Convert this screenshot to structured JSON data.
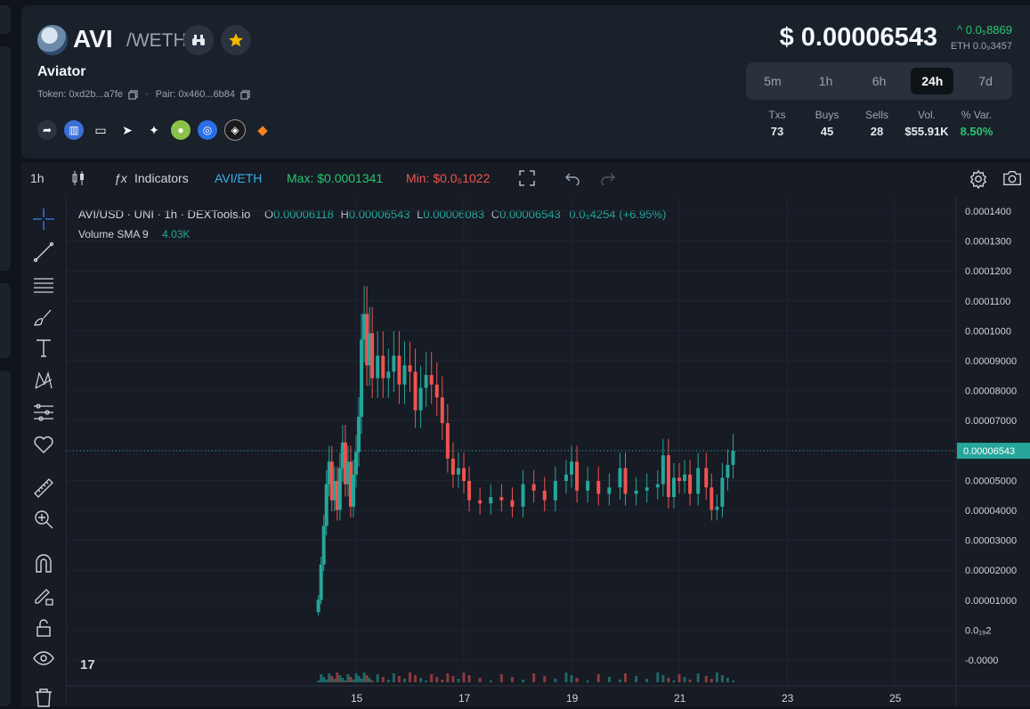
{
  "pair": {
    "base": "AVI",
    "quote": "/WETH",
    "name": "Aviator",
    "token_label": "Token: 0xd2b...a7fe",
    "pair_label": "Pair: 0x460...6b84"
  },
  "price": {
    "usd": "$ 0.00006543",
    "change": "^ 0.0₅8869",
    "eth": "ETH 0.0₉3457"
  },
  "timeframes": {
    "items": [
      "5m",
      "1h",
      "6h",
      "24h",
      "7d"
    ],
    "active": "24h"
  },
  "stats": {
    "txs_label": "Txs",
    "txs": "73",
    "buys_label": "Buys",
    "buys": "45",
    "sells_label": "Sells",
    "sells": "28",
    "vol_label": "Vol.",
    "vol": "$55.91K",
    "var_label": "% Var.",
    "var": "8.50%"
  },
  "toolbar": {
    "interval": "1h",
    "indicators": "Indicators",
    "pair": "AVI/ETH",
    "max": "Max: $0.0001341",
    "min": "Min: $0.0₅1022"
  },
  "legend": {
    "title": "AVI/USD · UNI · 1h · DEXTools.io",
    "o_lab": "O",
    "o": "0.00006118",
    "h_lab": "H",
    "h": "0.00006543",
    "l_lab": "L",
    "l": "0.00006083",
    "c_lab": "C",
    "c": "0.00006543",
    "delta": "0.0₅4254 (+6.95%)",
    "vol_label": "Volume SMA 9",
    "vol_val": "4.03K"
  },
  "colors": {
    "up": "#26a69a",
    "down": "#ef5350",
    "green": "#28c76f",
    "bg": "#161b24"
  },
  "chart_data": {
    "type": "candlestick",
    "x_ticks": [
      "15",
      "17",
      "19",
      "21",
      "23",
      "25"
    ],
    "y_ticks": [
      "0.0001400",
      "0.0001300",
      "0.0001200",
      "0.0001100",
      "0.0001000",
      "0.00009000",
      "0.00008000",
      "0.00007000",
      "0.00006000",
      "0.00005000",
      "0.00004000",
      "0.00003000",
      "0.00002000",
      "0.00001000",
      "0.0₁₉2",
      "-0.0000"
    ],
    "last_price_label": "0.00006543",
    "ylim": [
      0,
      0.00014
    ],
    "x_range": [
      13.5,
      25.5
    ],
    "series_close": [
      {
        "x": 14.3,
        "v": 1.9e-05
      },
      {
        "x": 14.35,
        "v": 3e-05
      },
      {
        "x": 14.4,
        "v": 4.2e-05
      },
      {
        "x": 14.45,
        "v": 5.5e-05
      },
      {
        "x": 14.5,
        "v": 6.2e-05
      },
      {
        "x": 14.55,
        "v": 5e-05
      },
      {
        "x": 14.6,
        "v": 5.6e-05
      },
      {
        "x": 14.65,
        "v": 4.7e-05
      },
      {
        "x": 14.7,
        "v": 6e-05
      },
      {
        "x": 14.75,
        "v": 6.8e-05
      },
      {
        "x": 14.8,
        "v": 5.5e-05
      },
      {
        "x": 14.85,
        "v": 6.2e-05
      },
      {
        "x": 14.9,
        "v": 4.8e-05
      },
      {
        "x": 14.95,
        "v": 5.8e-05
      },
      {
        "x": 15.0,
        "v": 6.5e-05
      },
      {
        "x": 15.05,
        "v": 7.6e-05
      },
      {
        "x": 15.1,
        "v": 0.0001
      },
      {
        "x": 15.15,
        "v": 0.000108
      },
      {
        "x": 15.2,
        "v": 9.2e-05
      },
      {
        "x": 15.25,
        "v": 0.000102
      },
      {
        "x": 15.3,
        "v": 8.8e-05
      },
      {
        "x": 15.4,
        "v": 9.5e-05
      },
      {
        "x": 15.5,
        "v": 8.8e-05
      },
      {
        "x": 15.6,
        "v": 9e-05
      },
      {
        "x": 15.7,
        "v": 9.5e-05
      },
      {
        "x": 15.8,
        "v": 8.6e-05
      },
      {
        "x": 15.9,
        "v": 9.2e-05
      },
      {
        "x": 16.0,
        "v": 9e-05
      },
      {
        "x": 16.1,
        "v": 7.8e-05
      },
      {
        "x": 16.2,
        "v": 8.5e-05
      },
      {
        "x": 16.3,
        "v": 8.9e-05
      },
      {
        "x": 16.4,
        "v": 8.6e-05
      },
      {
        "x": 16.5,
        "v": 8.2e-05
      },
      {
        "x": 16.6,
        "v": 7.4e-05
      },
      {
        "x": 16.7,
        "v": 6.3e-05
      },
      {
        "x": 16.8,
        "v": 5.8e-05
      },
      {
        "x": 16.9,
        "v": 6e-05
      },
      {
        "x": 17.0,
        "v": 5.6e-05
      },
      {
        "x": 17.1,
        "v": 5e-05
      },
      {
        "x": 17.3,
        "v": 4.9e-05
      },
      {
        "x": 17.5,
        "v": 5.1e-05
      },
      {
        "x": 17.7,
        "v": 5e-05
      },
      {
        "x": 17.9,
        "v": 4.8e-05
      },
      {
        "x": 18.1,
        "v": 5.5e-05
      },
      {
        "x": 18.3,
        "v": 5.3e-05
      },
      {
        "x": 18.5,
        "v": 5e-05
      },
      {
        "x": 18.7,
        "v": 5.6e-05
      },
      {
        "x": 18.9,
        "v": 5.8e-05
      },
      {
        "x": 19.0,
        "v": 6.2e-05
      },
      {
        "x": 19.1,
        "v": 5.3e-05
      },
      {
        "x": 19.3,
        "v": 5.6e-05
      },
      {
        "x": 19.5,
        "v": 5.2e-05
      },
      {
        "x": 19.7,
        "v": 5.4e-05
      },
      {
        "x": 19.9,
        "v": 6e-05
      },
      {
        "x": 20.0,
        "v": 5.2e-05
      },
      {
        "x": 20.2,
        "v": 5.3e-05
      },
      {
        "x": 20.4,
        "v": 5.4e-05
      },
      {
        "x": 20.6,
        "v": 5.5e-05
      },
      {
        "x": 20.7,
        "v": 6.4e-05
      },
      {
        "x": 20.8,
        "v": 5.1e-05
      },
      {
        "x": 20.9,
        "v": 5.7e-05
      },
      {
        "x": 21.0,
        "v": 5.6e-05
      },
      {
        "x": 21.1,
        "v": 5.8e-05
      },
      {
        "x": 21.2,
        "v": 5.2e-05
      },
      {
        "x": 21.35,
        "v": 6e-05
      },
      {
        "x": 21.5,
        "v": 5.4e-05
      },
      {
        "x": 21.6,
        "v": 4.7e-05
      },
      {
        "x": 21.7,
        "v": 4.8e-05
      },
      {
        "x": 21.8,
        "v": 5.7e-05
      },
      {
        "x": 21.9,
        "v": 6.1e-05
      },
      {
        "x": 22.0,
        "v": 6.54e-05
      }
    ]
  }
}
